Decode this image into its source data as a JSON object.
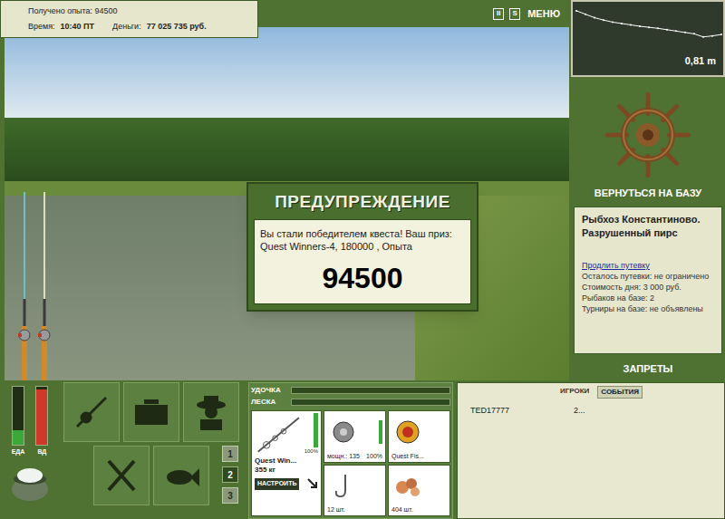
{
  "status": {
    "experience": "Получено опыта: 94500",
    "time_label": "Время:",
    "time": "10:40 ПТ",
    "money_label": "Деньги:",
    "money": "77 025 735 руб."
  },
  "top_controls": [
    {
      "label": "II"
    },
    {
      "label": "S"
    },
    {
      "label": "МЕНЮ"
    }
  ],
  "depth": {
    "reading": "0,81 m",
    "values": [
      0.05,
      0.15,
      0.25,
      0.32,
      0.38,
      0.42,
      0.46,
      0.5,
      0.53,
      0.56,
      0.6,
      0.64,
      0.68,
      0.72,
      0.81,
      0.78,
      0.74
    ]
  },
  "base_button": "ВЕРНУТЬСЯ НА БАЗУ",
  "location": {
    "title": "Рыбхоз Константиново. Разрушенный пирс",
    "link": "Продлить путевку",
    "lines": [
      "Осталось путевки: не ограничено",
      "Стоимость дня: 3 000 руб.",
      "Рыбаков на базе: 2",
      "Турниры на базе: не объявлены"
    ]
  },
  "bans_button": "ЗАПРЕТЫ",
  "dialog": {
    "title": "ПРЕДУПРЕЖДЕНИЕ",
    "message": "Вы стали победителем квеста! Ваш приз: Quest Winners-4, 180000 , Опыта",
    "value": "94500"
  },
  "scene_rods": [
    {
      "color": "#6fc0c8"
    },
    {
      "color": "#d8e0c0"
    }
  ],
  "meters": [
    {
      "label": "ЕДА",
      "level": 0.25,
      "color": "#3aa83a"
    },
    {
      "label": "ВД",
      "level": 0.95,
      "color": "#d0392a"
    }
  ],
  "pages": [
    {
      "label": "1",
      "selected": false
    },
    {
      "label": "2",
      "selected": true
    },
    {
      "label": "3",
      "selected": false
    }
  ],
  "tackle_bars": [
    {
      "label": "УДОЧКА",
      "level": 0
    },
    {
      "label": "ЛЕСКА",
      "level": 0
    }
  ],
  "rod_slot": {
    "name": "Quest Win...",
    "weight": "355 кг",
    "condition": "100%",
    "level": 1,
    "button": "НАСТРОИТЬ"
  },
  "slots": [
    {
      "kind": "reel",
      "caption": "мощн.: 135",
      "condition": "100%",
      "level": 1
    },
    {
      "kind": "line",
      "caption": "Quest Fis..."
    },
    {
      "kind": "hook",
      "caption": "12 шт."
    },
    {
      "kind": "bait",
      "caption": "404 шт."
    }
  ],
  "chat": {
    "tabs": [
      {
        "label": "ИГРОКИ",
        "selected": false
      },
      {
        "label": "СОБЫТИЯ",
        "selected": true
      }
    ],
    "rows": [
      {
        "name": "TED17777",
        "text": "2..."
      }
    ]
  }
}
